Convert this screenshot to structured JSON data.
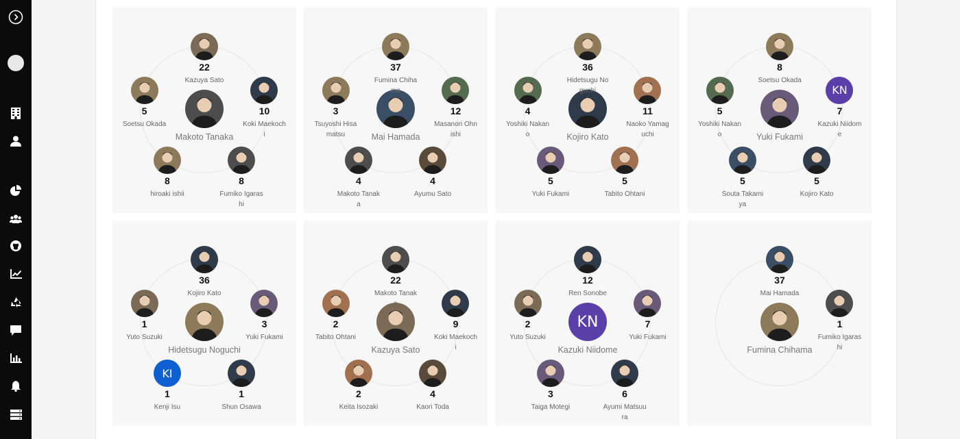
{
  "sidebar": {
    "toggle_icon": "chevron-right-circle-icon",
    "nav_icons": [
      "building-icon",
      "user-icon",
      "pie-chart-icon",
      "users-icon",
      "github-icon",
      "line-chart-icon",
      "recycle-icon",
      "comment-icon",
      "bar-chart-icon",
      "bell-icon",
      "server-icon"
    ]
  },
  "colors": {
    "sidebar": "#0b0b0b",
    "card": "#f7f7f7",
    "ring": "#e5e5e5",
    "kn_avatar": "#5b3fa8",
    "ki_avatar": "#0e5fd1"
  },
  "cards": [
    {
      "center": {
        "name": "Makoto Tanaka"
      },
      "satellites": [
        {
          "count": "22",
          "name": "Kazuya Sato"
        },
        {
          "count": "10",
          "name": "Koki Maekochi"
        },
        {
          "count": "8",
          "name": "Fumiko Igarashi"
        },
        {
          "count": "8",
          "name": "hiroaki ishii"
        },
        {
          "count": "5",
          "name": "Soetsu Okada"
        }
      ]
    },
    {
      "center": {
        "name": "Mai Hamada"
      },
      "satellites": [
        {
          "count": "37",
          "name": "Fumina Chihama"
        },
        {
          "count": "12",
          "name": "Masanori Ohnishi"
        },
        {
          "count": "4",
          "name": "Ayumu Sato"
        },
        {
          "count": "4",
          "name": "Makoto Tanaka"
        },
        {
          "count": "3",
          "name": "Tsuyoshi Hisamatsu"
        }
      ]
    },
    {
      "center": {
        "name": "Kojiro Kato"
      },
      "satellites": [
        {
          "count": "36",
          "name": "Hidetsugu Noguchi"
        },
        {
          "count": "11",
          "name": "Naoko Yamaguchi"
        },
        {
          "count": "5",
          "name": "Tabito Ohtani"
        },
        {
          "count": "5",
          "name": "Yuki Fukami"
        },
        {
          "count": "4",
          "name": "Yoshiki Nakano"
        }
      ]
    },
    {
      "center": {
        "name": "Yuki Fukami"
      },
      "satellites": [
        {
          "count": "8",
          "name": "Soetsu Okada"
        },
        {
          "count": "7",
          "name": "Kazuki Niidome",
          "initials": "KN"
        },
        {
          "count": "5",
          "name": "Kojiro Kato"
        },
        {
          "count": "5",
          "name": "Souta Takamiya"
        },
        {
          "count": "5",
          "name": "Yoshiki Nakano"
        }
      ]
    },
    {
      "center": {
        "name": "Hidetsugu Noguchi"
      },
      "satellites": [
        {
          "count": "36",
          "name": "Kojiro Kato"
        },
        {
          "count": "3",
          "name": "Yuki Fukami"
        },
        {
          "count": "1",
          "name": "Shun Osawa"
        },
        {
          "count": "1",
          "name": "Kenji Isu",
          "initials": "KI"
        },
        {
          "count": "1",
          "name": "Yuto Suzuki"
        }
      ]
    },
    {
      "center": {
        "name": "Kazuya Sato"
      },
      "satellites": [
        {
          "count": "22",
          "name": "Makoto Tanaka"
        },
        {
          "count": "9",
          "name": "Koki Maekochi"
        },
        {
          "count": "4",
          "name": "Kaori Toda"
        },
        {
          "count": "2",
          "name": "Keita Isozaki"
        },
        {
          "count": "2",
          "name": "Tabito Ohtani"
        }
      ]
    },
    {
      "center": {
        "name": "Kazuki Niidome",
        "initials": "KN"
      },
      "satellites": [
        {
          "count": "12",
          "name": "Ren Sonobe"
        },
        {
          "count": "7",
          "name": "Yuki Fukami"
        },
        {
          "count": "6",
          "name": "Ayumi Matsuura"
        },
        {
          "count": "3",
          "name": "Taiga Motegi"
        },
        {
          "count": "2",
          "name": "Yuto Suzuki"
        }
      ]
    },
    {
      "center": {
        "name": "Fumina Chihama"
      },
      "satellites": [
        {
          "count": "37",
          "name": "Mai Hamada"
        },
        {
          "count": "1",
          "name": "Fumiko Igarashi"
        }
      ]
    }
  ]
}
